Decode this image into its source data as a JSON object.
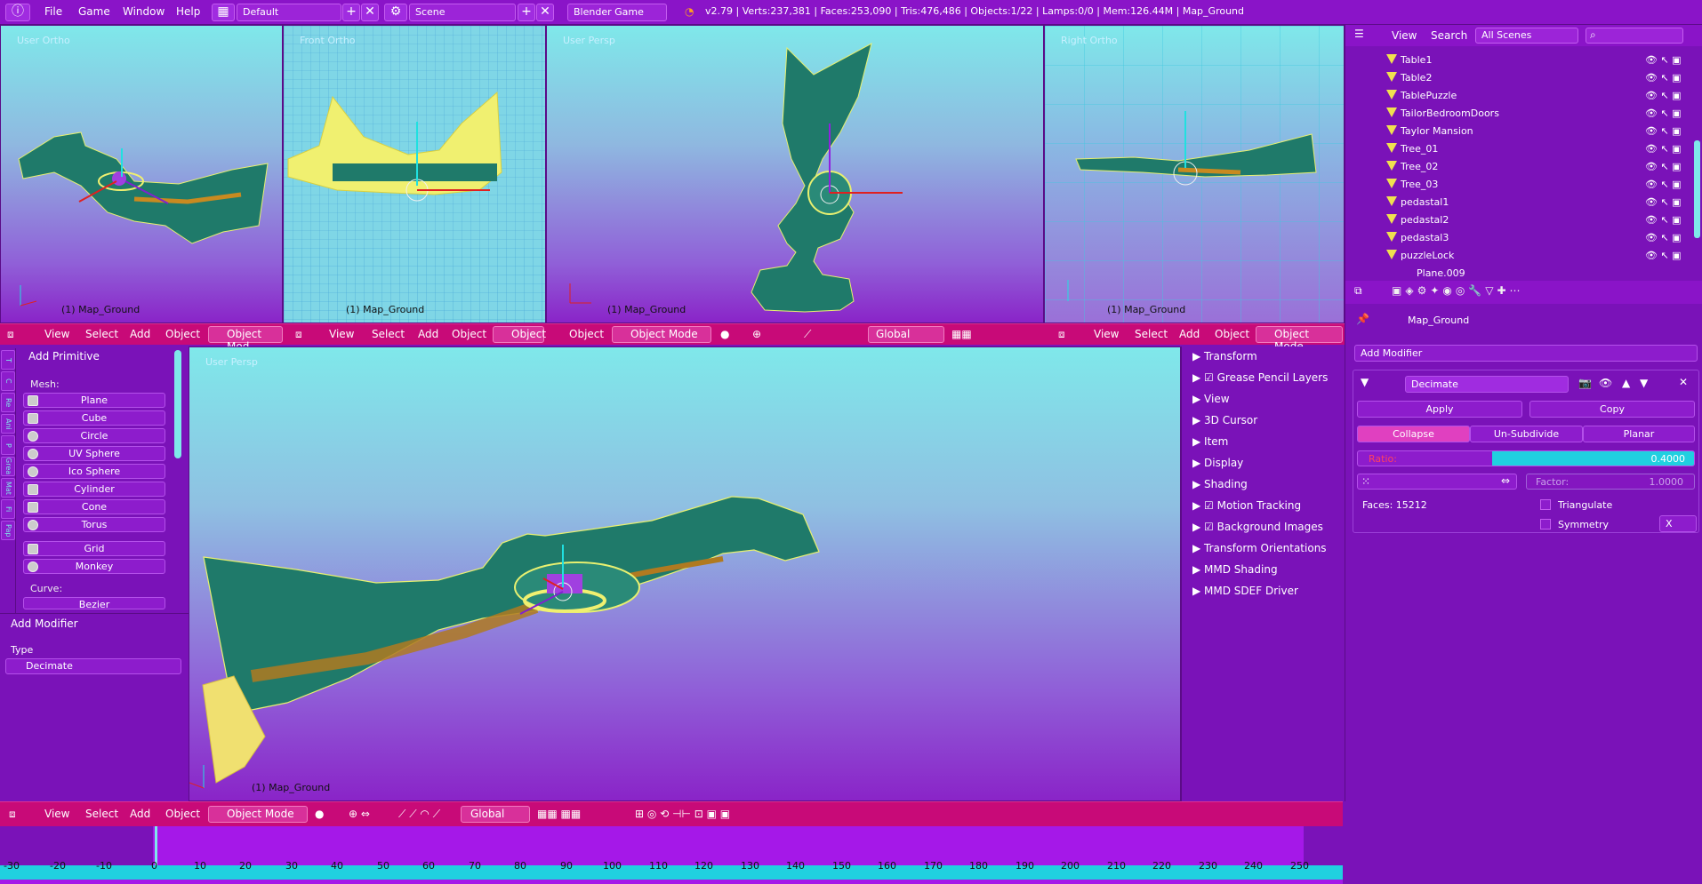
{
  "topbar": {
    "menus": [
      "File",
      "Game",
      "Window",
      "Help"
    ],
    "layout": "Default",
    "scene": "Scene",
    "engine": "Blender Game",
    "stats": "v2.79 | Verts:237,381 | Faces:253,090 | Tris:476,486 | Objects:1/22 | Lamps:0/0 | Mem:126.44M | Map_Ground"
  },
  "viewports": {
    "v1": {
      "label": "User Ortho",
      "object": "(1) Map_Ground"
    },
    "v2": {
      "label": "Front Ortho",
      "object": "(1) Map_Ground"
    },
    "v3": {
      "label": "User Persp",
      "object": "(1) Map_Ground"
    },
    "v4": {
      "label": "Right Ortho",
      "object": "(1) Map_Ground"
    },
    "main": {
      "label": "User Persp",
      "object": "(1) Map_Ground"
    }
  },
  "view_menu": {
    "view": "View",
    "select": "Select",
    "add": "Add",
    "object": "Object",
    "mode": "Object Mode",
    "mode_short": "Object Mod",
    "mode_trunc": "Object",
    "orientation": "Global"
  },
  "outliner": {
    "view": "View",
    "search": "Search",
    "scenes": "All Scenes",
    "rows": [
      "Table1",
      "Table2",
      "TablePuzzle",
      "TailorBedroomDoors",
      "Taylor Mansion",
      "Tree_01",
      "Tree_02",
      "Tree_03",
      "pedastal1",
      "pedastal2",
      "pedastal3",
      "puzzleLock",
      "Plane.009"
    ]
  },
  "toolshelf": {
    "tabs": [
      "T",
      "C",
      "Re",
      "Ani",
      "P",
      "Grea",
      "Mat",
      "Fi",
      "Pap"
    ],
    "panel_title": "Add Primitive",
    "mesh_label": "Mesh:",
    "mesh": [
      "Plane",
      "Cube",
      "Circle",
      "UV Sphere",
      "Ico Sphere",
      "Cylinder",
      "Cone",
      "Torus"
    ],
    "extra": [
      "Grid",
      "Monkey"
    ],
    "curve_label": "Curve:",
    "curve": [
      "Bezier"
    ],
    "op_title": "Add Modifier",
    "type_label": "Type",
    "type_value": "Decimate"
  },
  "npanel": {
    "items": [
      "Transform",
      "Grease Pencil Layers",
      "View",
      "3D Cursor",
      "Item",
      "Display",
      "Shading",
      "Motion Tracking",
      "Background Images",
      "Transform Orientations",
      "MMD Shading",
      "MMD SDEF Driver"
    ]
  },
  "properties": {
    "object": "Map_Ground",
    "add_modifier": "Add Modifier",
    "modifier_name": "Decimate",
    "apply": "Apply",
    "copy": "Copy",
    "modes": [
      "Collapse",
      "Un-Subdivide",
      "Planar"
    ],
    "ratio_label": "Ratio:",
    "ratio_value": "0.4000",
    "ratio": 0.4,
    "factor_label": "Factor:",
    "factor_value": "1.0000",
    "faces": "Faces: 15212",
    "triangulate": "Triangulate",
    "symmetry": "Symmetry",
    "axis": "X"
  },
  "timeline": {
    "ticks": [
      "-30",
      "-20",
      "-10",
      "0",
      "10",
      "20",
      "30",
      "40",
      "50",
      "60",
      "70",
      "80",
      "90",
      "100",
      "110",
      "120",
      "130",
      "140",
      "150",
      "160",
      "170",
      "180",
      "190",
      "200",
      "210",
      "220",
      "230",
      "240",
      "250"
    ]
  },
  "colors": {
    "accent": "#c80a78",
    "bg": "#7a12b8",
    "sky": "#7fe8ea",
    "terrain": "#1f7a6a"
  }
}
